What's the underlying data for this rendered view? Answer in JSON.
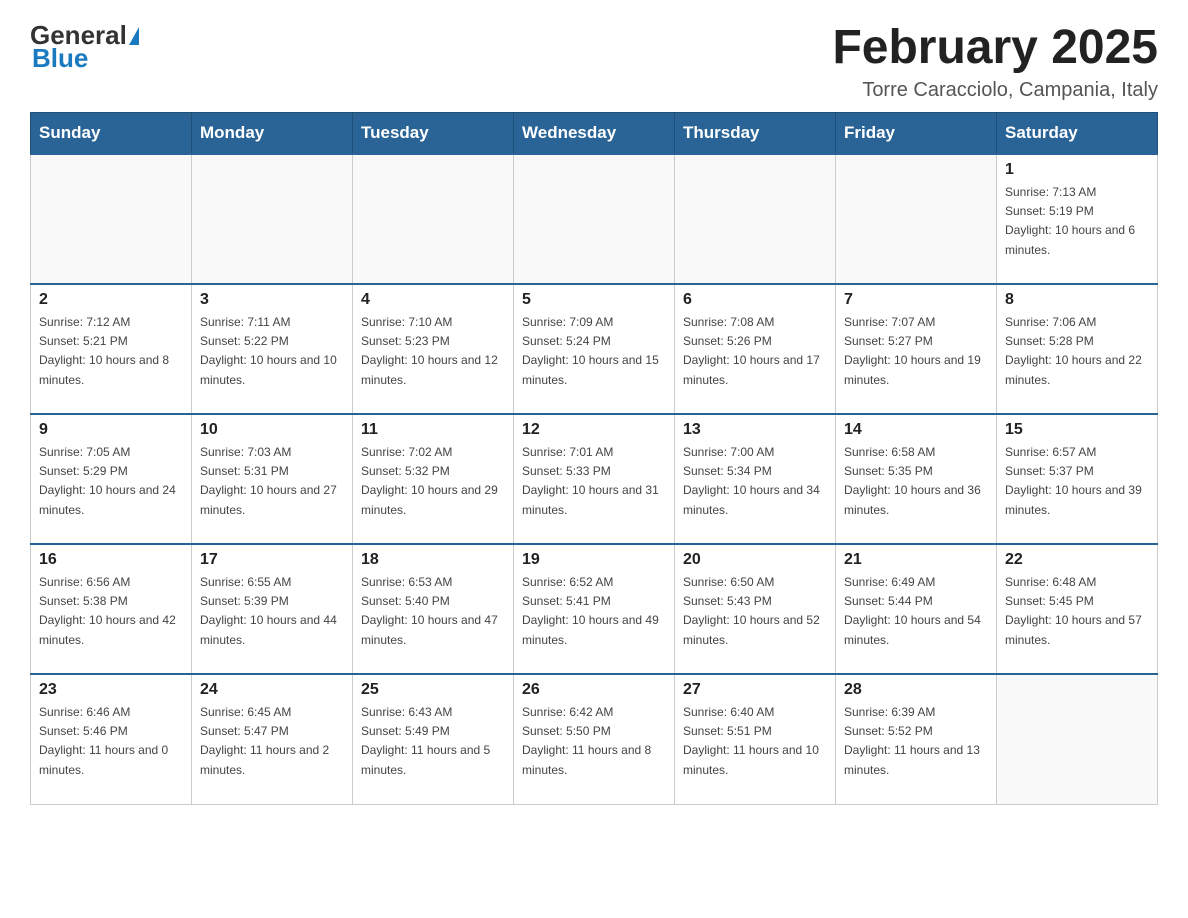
{
  "header": {
    "logo": {
      "general": "General",
      "blue": "Blue"
    },
    "title": "February 2025",
    "subtitle": "Torre Caracciolo, Campania, Italy"
  },
  "days_of_week": [
    "Sunday",
    "Monday",
    "Tuesday",
    "Wednesday",
    "Thursday",
    "Friday",
    "Saturday"
  ],
  "weeks": [
    [
      {
        "day": "",
        "info": ""
      },
      {
        "day": "",
        "info": ""
      },
      {
        "day": "",
        "info": ""
      },
      {
        "day": "",
        "info": ""
      },
      {
        "day": "",
        "info": ""
      },
      {
        "day": "",
        "info": ""
      },
      {
        "day": "1",
        "info": "Sunrise: 7:13 AM\nSunset: 5:19 PM\nDaylight: 10 hours and 6 minutes."
      }
    ],
    [
      {
        "day": "2",
        "info": "Sunrise: 7:12 AM\nSunset: 5:21 PM\nDaylight: 10 hours and 8 minutes."
      },
      {
        "day": "3",
        "info": "Sunrise: 7:11 AM\nSunset: 5:22 PM\nDaylight: 10 hours and 10 minutes."
      },
      {
        "day": "4",
        "info": "Sunrise: 7:10 AM\nSunset: 5:23 PM\nDaylight: 10 hours and 12 minutes."
      },
      {
        "day": "5",
        "info": "Sunrise: 7:09 AM\nSunset: 5:24 PM\nDaylight: 10 hours and 15 minutes."
      },
      {
        "day": "6",
        "info": "Sunrise: 7:08 AM\nSunset: 5:26 PM\nDaylight: 10 hours and 17 minutes."
      },
      {
        "day": "7",
        "info": "Sunrise: 7:07 AM\nSunset: 5:27 PM\nDaylight: 10 hours and 19 minutes."
      },
      {
        "day": "8",
        "info": "Sunrise: 7:06 AM\nSunset: 5:28 PM\nDaylight: 10 hours and 22 minutes."
      }
    ],
    [
      {
        "day": "9",
        "info": "Sunrise: 7:05 AM\nSunset: 5:29 PM\nDaylight: 10 hours and 24 minutes."
      },
      {
        "day": "10",
        "info": "Sunrise: 7:03 AM\nSunset: 5:31 PM\nDaylight: 10 hours and 27 minutes."
      },
      {
        "day": "11",
        "info": "Sunrise: 7:02 AM\nSunset: 5:32 PM\nDaylight: 10 hours and 29 minutes."
      },
      {
        "day": "12",
        "info": "Sunrise: 7:01 AM\nSunset: 5:33 PM\nDaylight: 10 hours and 31 minutes."
      },
      {
        "day": "13",
        "info": "Sunrise: 7:00 AM\nSunset: 5:34 PM\nDaylight: 10 hours and 34 minutes."
      },
      {
        "day": "14",
        "info": "Sunrise: 6:58 AM\nSunset: 5:35 PM\nDaylight: 10 hours and 36 minutes."
      },
      {
        "day": "15",
        "info": "Sunrise: 6:57 AM\nSunset: 5:37 PM\nDaylight: 10 hours and 39 minutes."
      }
    ],
    [
      {
        "day": "16",
        "info": "Sunrise: 6:56 AM\nSunset: 5:38 PM\nDaylight: 10 hours and 42 minutes."
      },
      {
        "day": "17",
        "info": "Sunrise: 6:55 AM\nSunset: 5:39 PM\nDaylight: 10 hours and 44 minutes."
      },
      {
        "day": "18",
        "info": "Sunrise: 6:53 AM\nSunset: 5:40 PM\nDaylight: 10 hours and 47 minutes."
      },
      {
        "day": "19",
        "info": "Sunrise: 6:52 AM\nSunset: 5:41 PM\nDaylight: 10 hours and 49 minutes."
      },
      {
        "day": "20",
        "info": "Sunrise: 6:50 AM\nSunset: 5:43 PM\nDaylight: 10 hours and 52 minutes."
      },
      {
        "day": "21",
        "info": "Sunrise: 6:49 AM\nSunset: 5:44 PM\nDaylight: 10 hours and 54 minutes."
      },
      {
        "day": "22",
        "info": "Sunrise: 6:48 AM\nSunset: 5:45 PM\nDaylight: 10 hours and 57 minutes."
      }
    ],
    [
      {
        "day": "23",
        "info": "Sunrise: 6:46 AM\nSunset: 5:46 PM\nDaylight: 11 hours and 0 minutes."
      },
      {
        "day": "24",
        "info": "Sunrise: 6:45 AM\nSunset: 5:47 PM\nDaylight: 11 hours and 2 minutes."
      },
      {
        "day": "25",
        "info": "Sunrise: 6:43 AM\nSunset: 5:49 PM\nDaylight: 11 hours and 5 minutes."
      },
      {
        "day": "26",
        "info": "Sunrise: 6:42 AM\nSunset: 5:50 PM\nDaylight: 11 hours and 8 minutes."
      },
      {
        "day": "27",
        "info": "Sunrise: 6:40 AM\nSunset: 5:51 PM\nDaylight: 11 hours and 10 minutes."
      },
      {
        "day": "28",
        "info": "Sunrise: 6:39 AM\nSunset: 5:52 PM\nDaylight: 11 hours and 13 minutes."
      },
      {
        "day": "",
        "info": ""
      }
    ]
  ]
}
